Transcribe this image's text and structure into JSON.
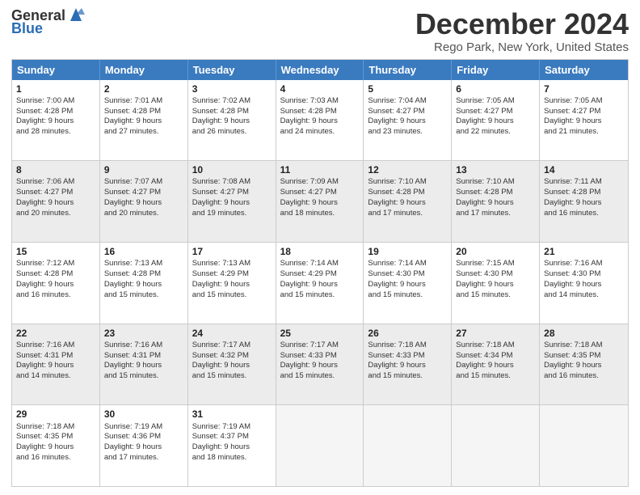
{
  "header": {
    "logo_general": "General",
    "logo_blue": "Blue",
    "title": "December 2024",
    "subtitle": "Rego Park, New York, United States"
  },
  "weekdays": [
    "Sunday",
    "Monday",
    "Tuesday",
    "Wednesday",
    "Thursday",
    "Friday",
    "Saturday"
  ],
  "rows": [
    [
      {
        "day": "1",
        "lines": [
          "Sunrise: 7:00 AM",
          "Sunset: 4:28 PM",
          "Daylight: 9 hours",
          "and 28 minutes."
        ]
      },
      {
        "day": "2",
        "lines": [
          "Sunrise: 7:01 AM",
          "Sunset: 4:28 PM",
          "Daylight: 9 hours",
          "and 27 minutes."
        ]
      },
      {
        "day": "3",
        "lines": [
          "Sunrise: 7:02 AM",
          "Sunset: 4:28 PM",
          "Daylight: 9 hours",
          "and 26 minutes."
        ]
      },
      {
        "day": "4",
        "lines": [
          "Sunrise: 7:03 AM",
          "Sunset: 4:28 PM",
          "Daylight: 9 hours",
          "and 24 minutes."
        ]
      },
      {
        "day": "5",
        "lines": [
          "Sunrise: 7:04 AM",
          "Sunset: 4:27 PM",
          "Daylight: 9 hours",
          "and 23 minutes."
        ]
      },
      {
        "day": "6",
        "lines": [
          "Sunrise: 7:05 AM",
          "Sunset: 4:27 PM",
          "Daylight: 9 hours",
          "and 22 minutes."
        ]
      },
      {
        "day": "7",
        "lines": [
          "Sunrise: 7:05 AM",
          "Sunset: 4:27 PM",
          "Daylight: 9 hours",
          "and 21 minutes."
        ]
      }
    ],
    [
      {
        "day": "8",
        "lines": [
          "Sunrise: 7:06 AM",
          "Sunset: 4:27 PM",
          "Daylight: 9 hours",
          "and 20 minutes."
        ]
      },
      {
        "day": "9",
        "lines": [
          "Sunrise: 7:07 AM",
          "Sunset: 4:27 PM",
          "Daylight: 9 hours",
          "and 20 minutes."
        ]
      },
      {
        "day": "10",
        "lines": [
          "Sunrise: 7:08 AM",
          "Sunset: 4:27 PM",
          "Daylight: 9 hours",
          "and 19 minutes."
        ]
      },
      {
        "day": "11",
        "lines": [
          "Sunrise: 7:09 AM",
          "Sunset: 4:27 PM",
          "Daylight: 9 hours",
          "and 18 minutes."
        ]
      },
      {
        "day": "12",
        "lines": [
          "Sunrise: 7:10 AM",
          "Sunset: 4:28 PM",
          "Daylight: 9 hours",
          "and 17 minutes."
        ]
      },
      {
        "day": "13",
        "lines": [
          "Sunrise: 7:10 AM",
          "Sunset: 4:28 PM",
          "Daylight: 9 hours",
          "and 17 minutes."
        ]
      },
      {
        "day": "14",
        "lines": [
          "Sunrise: 7:11 AM",
          "Sunset: 4:28 PM",
          "Daylight: 9 hours",
          "and 16 minutes."
        ]
      }
    ],
    [
      {
        "day": "15",
        "lines": [
          "Sunrise: 7:12 AM",
          "Sunset: 4:28 PM",
          "Daylight: 9 hours",
          "and 16 minutes."
        ]
      },
      {
        "day": "16",
        "lines": [
          "Sunrise: 7:13 AM",
          "Sunset: 4:28 PM",
          "Daylight: 9 hours",
          "and 15 minutes."
        ]
      },
      {
        "day": "17",
        "lines": [
          "Sunrise: 7:13 AM",
          "Sunset: 4:29 PM",
          "Daylight: 9 hours",
          "and 15 minutes."
        ]
      },
      {
        "day": "18",
        "lines": [
          "Sunrise: 7:14 AM",
          "Sunset: 4:29 PM",
          "Daylight: 9 hours",
          "and 15 minutes."
        ]
      },
      {
        "day": "19",
        "lines": [
          "Sunrise: 7:14 AM",
          "Sunset: 4:30 PM",
          "Daylight: 9 hours",
          "and 15 minutes."
        ]
      },
      {
        "day": "20",
        "lines": [
          "Sunrise: 7:15 AM",
          "Sunset: 4:30 PM",
          "Daylight: 9 hours",
          "and 15 minutes."
        ]
      },
      {
        "day": "21",
        "lines": [
          "Sunrise: 7:16 AM",
          "Sunset: 4:30 PM",
          "Daylight: 9 hours",
          "and 14 minutes."
        ]
      }
    ],
    [
      {
        "day": "22",
        "lines": [
          "Sunrise: 7:16 AM",
          "Sunset: 4:31 PM",
          "Daylight: 9 hours",
          "and 14 minutes."
        ]
      },
      {
        "day": "23",
        "lines": [
          "Sunrise: 7:16 AM",
          "Sunset: 4:31 PM",
          "Daylight: 9 hours",
          "and 15 minutes."
        ]
      },
      {
        "day": "24",
        "lines": [
          "Sunrise: 7:17 AM",
          "Sunset: 4:32 PM",
          "Daylight: 9 hours",
          "and 15 minutes."
        ]
      },
      {
        "day": "25",
        "lines": [
          "Sunrise: 7:17 AM",
          "Sunset: 4:33 PM",
          "Daylight: 9 hours",
          "and 15 minutes."
        ]
      },
      {
        "day": "26",
        "lines": [
          "Sunrise: 7:18 AM",
          "Sunset: 4:33 PM",
          "Daylight: 9 hours",
          "and 15 minutes."
        ]
      },
      {
        "day": "27",
        "lines": [
          "Sunrise: 7:18 AM",
          "Sunset: 4:34 PM",
          "Daylight: 9 hours",
          "and 15 minutes."
        ]
      },
      {
        "day": "28",
        "lines": [
          "Sunrise: 7:18 AM",
          "Sunset: 4:35 PM",
          "Daylight: 9 hours",
          "and 16 minutes."
        ]
      }
    ],
    [
      {
        "day": "29",
        "lines": [
          "Sunrise: 7:18 AM",
          "Sunset: 4:35 PM",
          "Daylight: 9 hours",
          "and 16 minutes."
        ]
      },
      {
        "day": "30",
        "lines": [
          "Sunrise: 7:19 AM",
          "Sunset: 4:36 PM",
          "Daylight: 9 hours",
          "and 17 minutes."
        ]
      },
      {
        "day": "31",
        "lines": [
          "Sunrise: 7:19 AM",
          "Sunset: 4:37 PM",
          "Daylight: 9 hours",
          "and 18 minutes."
        ]
      },
      null,
      null,
      null,
      null
    ]
  ]
}
